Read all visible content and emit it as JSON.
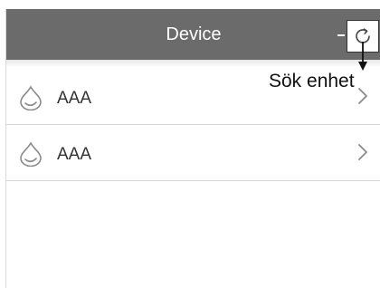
{
  "header": {
    "title": "Device",
    "refresh_icon": "refresh-icon",
    "callout_label": "Sök enhet"
  },
  "devices": [
    {
      "name": "AAA",
      "icon": "water-drop-icon"
    },
    {
      "name": "AAA",
      "icon": "water-drop-icon"
    }
  ],
  "colors": {
    "header_bg": "#6b6b6b",
    "header_text": "#ffffff",
    "divider": "#d6d6d6"
  }
}
